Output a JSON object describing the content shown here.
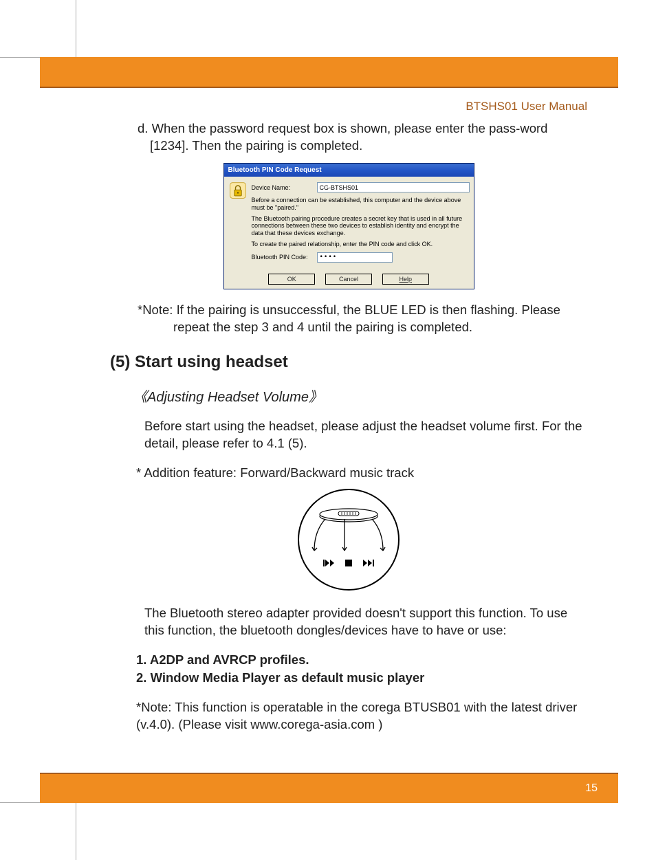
{
  "header": {
    "manual_title": "BTSHS01 User Manual"
  },
  "step_d": {
    "prefix": "d.",
    "text": "When the password request box is shown, please enter the pass-word [1234]. Then the pairing is completed."
  },
  "dialog": {
    "title": "Bluetooth PIN Code Request",
    "device_name_label": "Device Name:",
    "device_name_value": "CG-BTSHS01",
    "para1": "Before a connection can be established, this computer and the device above must be \"paired.\"",
    "para2": "The Bluetooth pairing procedure creates a secret key that is used in all future connections between these two devices to establish identity and encrypt the data that these devices exchange.",
    "para3": "To create the paired relationship, enter the PIN code and click OK.",
    "pin_label": "Bluetooth PIN Code:",
    "pin_value": "••••",
    "ok": "OK",
    "cancel": "Cancel",
    "help": "Help"
  },
  "note1": {
    "prefix": "*Note:",
    "text": "If the pairing is unsuccessful, the BLUE LED is then flashing. Please repeat the step 3 and 4 until the pairing is completed."
  },
  "section5": {
    "heading": "(5) Start using headset",
    "subsection": "《Adjusting Headset Volume》",
    "para": "Before start using the headset, please adjust the headset volume first. For the detail, please refer to 4.1 (5).",
    "additional": "* Addition feature: Forward/Backward music track",
    "controls": {
      "prev": "◂◂",
      "stop": "■",
      "next": "▸▸"
    },
    "para2": "The Bluetooth stereo adapter provided doesn't support this function. To use this function,  the bluetooth dongles/devices have to have or use:",
    "list": {
      "item1": "1. A2DP and AVRCP profiles.",
      "item2": "2. Window Media Player as default music player"
    },
    "note2": {
      "prefix": "*Note:",
      "text": "This function is operatable in the corega BTUSB01 with the latest driver (v.4.0). (Please visit www.corega-asia.com )"
    }
  },
  "page_number": "15"
}
